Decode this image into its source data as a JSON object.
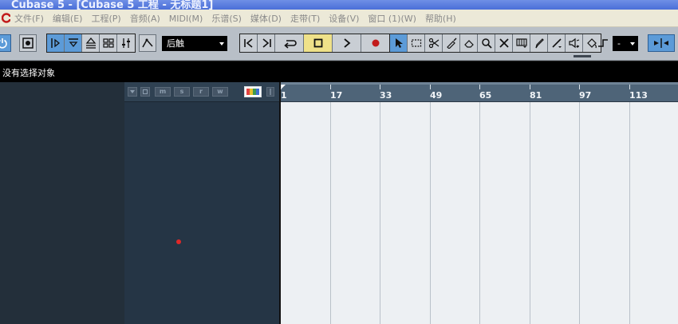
{
  "window": {
    "title": "Cubase 5 - [Cubase 5 工程 - 无标题1]"
  },
  "menu": {
    "items": [
      "文件(F)",
      "编辑(E)",
      "工程(P)",
      "音频(A)",
      "MIDI(M)",
      "乐谱(S)",
      "媒体(D)",
      "走带(T)",
      "设备(V)",
      "窗口 (1)(W)",
      "帮助(H)"
    ]
  },
  "toolbar": {
    "automation_mode": "后触",
    "quantize_value": "-"
  },
  "status": {
    "message": "没有选择对象"
  },
  "tracklist_header": {
    "buttons": [
      "m",
      "s",
      "r",
      "w"
    ]
  },
  "ruler": {
    "labels": [
      "1",
      "17",
      "33",
      "49",
      "65",
      "81",
      "97",
      "113"
    ]
  },
  "colors": {
    "accent_blue": "#5c9bd8",
    "record_red": "#c21b1b",
    "stop_yellow": "#efe189"
  }
}
